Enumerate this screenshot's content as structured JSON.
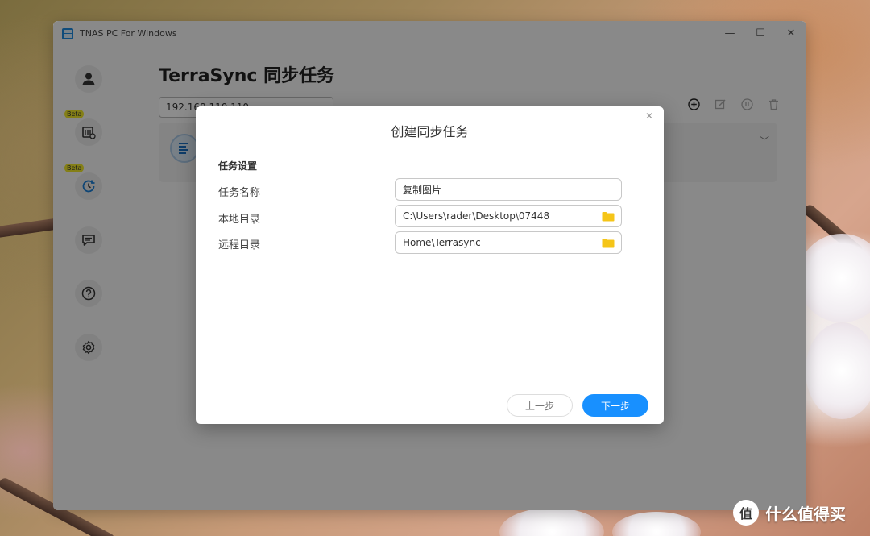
{
  "window": {
    "title": "TNAS PC For Windows",
    "controls": {
      "minimize": "—",
      "maximize": "☐",
      "close": "✕"
    }
  },
  "sidebar": {
    "items": [
      {
        "icon": "user-icon",
        "badge": ""
      },
      {
        "icon": "sync-device-icon",
        "badge": "Beta"
      },
      {
        "icon": "backup-clock-icon",
        "badge": "Beta"
      },
      {
        "icon": "message-icon",
        "badge": ""
      },
      {
        "icon": "help-icon",
        "badge": ""
      },
      {
        "icon": "settings-icon",
        "badge": ""
      }
    ]
  },
  "main": {
    "title": "TerraSync 同步任务",
    "server_address": "192.168.110.110",
    "toolbar_icons": [
      "add-icon",
      "edit-icon",
      "pause-icon",
      "delete-icon"
    ]
  },
  "dialog": {
    "title": "创建同步任务",
    "close_label": "✕",
    "section_title": "任务设置",
    "fields": [
      {
        "label": "任务名称",
        "value": "复制图片"
      },
      {
        "label": "本地目录",
        "value": "C:\\Users\\rader\\Desktop\\07448"
      },
      {
        "label": "远程目录",
        "value": "Home\\Terrasync"
      }
    ],
    "prev_button": "上一步",
    "next_button": "下一步"
  },
  "colors": {
    "accent": "#1890ff",
    "folder": "#f5c518",
    "beta_badge": "#f0e82a"
  },
  "watermark": {
    "icon_text": "值",
    "text": "什么值得买"
  }
}
